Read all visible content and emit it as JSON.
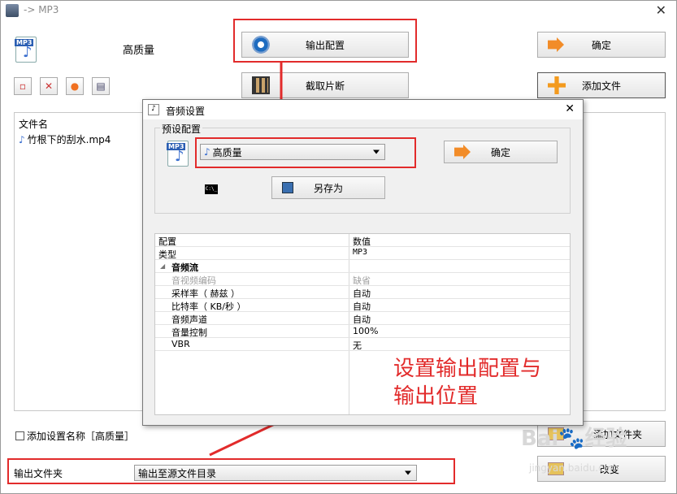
{
  "window": {
    "title": "-> MP3"
  },
  "top": {
    "quality_label": "高质量",
    "output_config_button": "输出配置",
    "ok_button": "确定",
    "trim_button": "截取片断",
    "add_file_button": "添加文件"
  },
  "file_list": {
    "header": "文件名",
    "items": [
      "竹根下的刮水.mp4"
    ]
  },
  "bottom": {
    "add_setting_name_label": "添加设置名称［高质量］",
    "add_folder_button": "添加文件夹",
    "output_folder_label": "输出文件夹",
    "output_folder_value": "输出至源文件目录",
    "change_button": "改变"
  },
  "dialog": {
    "title": "音频设置",
    "preset_group_label": "预设配置",
    "preset_value": "高质量",
    "ok_button": "确定",
    "save_as_button": "另存为",
    "cmd_icon_text": "C:\\_",
    "table": {
      "headers": [
        "配置",
        "数值"
      ],
      "rows": [
        {
          "name": "类型",
          "value": "MP3",
          "kind": "top"
        },
        {
          "name": "音频流",
          "value": "",
          "kind": "section"
        },
        {
          "name": "音视频编码",
          "value": "缺省",
          "kind": "dim"
        },
        {
          "name": "采样率（ 赫兹 ）",
          "value": "自动",
          "kind": "sub"
        },
        {
          "name": "比特率（ KB/秒 ）",
          "value": "自动",
          "kind": "sub"
        },
        {
          "name": "音频声道",
          "value": "自动",
          "kind": "sub"
        },
        {
          "name": "音量控制",
          "value": "100%",
          "kind": "sub"
        },
        {
          "name": "VBR",
          "value": "无",
          "kind": "sub"
        }
      ]
    }
  },
  "annotation": {
    "line1": "设置输出配置与",
    "line2": "输出位置"
  },
  "watermark": {
    "brand": "Bai",
    "brand2": "经验",
    "url": "jingyan.baidu.com"
  },
  "colors": {
    "highlight": "#e22b2b",
    "accent_orange": "#f28c28"
  }
}
